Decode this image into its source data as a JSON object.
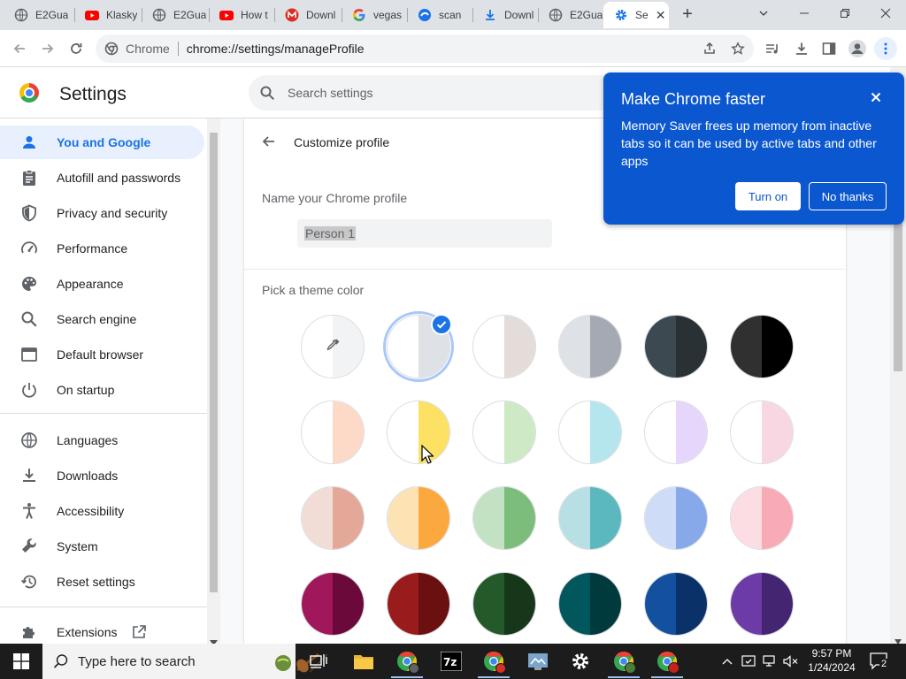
{
  "tabs": [
    {
      "title": "E2Gua",
      "icon": "globe-icon"
    },
    {
      "title": "Klasky",
      "icon": "youtube-icon"
    },
    {
      "title": "E2Gua",
      "icon": "globe-icon"
    },
    {
      "title": "How t",
      "icon": "youtube-icon"
    },
    {
      "title": "Downl",
      "icon": "m-logo-icon"
    },
    {
      "title": "vegas",
      "icon": "google-icon"
    },
    {
      "title": "scan",
      "icon": "swirl-icon"
    },
    {
      "title": "Downl",
      "icon": "download-icon"
    },
    {
      "title": "E2Gua",
      "icon": "globe-icon"
    },
    {
      "title": "Se",
      "icon": "gear-icon"
    }
  ],
  "omnibox": {
    "site_label": "Chrome",
    "url": "chrome://settings/manageProfile"
  },
  "header": {
    "title": "Settings",
    "search_placeholder": "Search settings"
  },
  "sidebar": {
    "items": [
      {
        "label": "You and Google",
        "icon": "person-icon",
        "selected": true
      },
      {
        "label": "Autofill and passwords",
        "icon": "clipboard-icon"
      },
      {
        "label": "Privacy and security",
        "icon": "shield-icon"
      },
      {
        "label": "Performance",
        "icon": "gauge-icon"
      },
      {
        "label": "Appearance",
        "icon": "palette-icon"
      },
      {
        "label": "Search engine",
        "icon": "search-icon"
      },
      {
        "label": "Default browser",
        "icon": "browser-icon"
      },
      {
        "label": "On startup",
        "icon": "power-icon"
      },
      {
        "label": "Languages",
        "icon": "globe-icon"
      },
      {
        "label": "Downloads",
        "icon": "download-icon"
      },
      {
        "label": "Accessibility",
        "icon": "accessibility-icon"
      },
      {
        "label": "System",
        "icon": "wrench-icon"
      },
      {
        "label": "Reset settings",
        "icon": "history-icon"
      },
      {
        "label": "Extensions",
        "icon": "puzzle-icon"
      }
    ]
  },
  "main": {
    "page_title": "Customize profile",
    "name_label": "Name your Chrome profile",
    "name_value": "Person 1",
    "theme_label": "Pick a theme color",
    "swatches": [
      {
        "left": "#ffffff",
        "right": "#f1f3f4"
      },
      {
        "left": "#ffffff",
        "right": "#dee1e6",
        "selected": true
      },
      {
        "left": "#ffffff",
        "right": "#e3dcd8"
      },
      {
        "left": "#dee1e6",
        "right": "#a5a9b4"
      },
      {
        "left": "#3c4950",
        "right": "#2a3135"
      },
      {
        "left": "#303030",
        "right": "#000000"
      },
      {
        "left": "#ffffff",
        "right": "#fdd9c7"
      },
      {
        "left": "#ffffff",
        "right": "#fde164"
      },
      {
        "left": "#ffffff",
        "right": "#cdeac5"
      },
      {
        "left": "#ffffff",
        "right": "#b5e6ee"
      },
      {
        "left": "#ffffff",
        "right": "#e6d6fc"
      },
      {
        "left": "#ffffff",
        "right": "#f8d7e3"
      },
      {
        "left": "#f2ddd6",
        "right": "#e3a897"
      },
      {
        "left": "#fde3b4",
        "right": "#fba93e"
      },
      {
        "left": "#c2e2c3",
        "right": "#7cbd7c"
      },
      {
        "left": "#b8e0e4",
        "right": "#5bb8bf"
      },
      {
        "left": "#cedcf8",
        "right": "#87a9ea"
      },
      {
        "left": "#fcdde3",
        "right": "#f8aab7"
      },
      {
        "left": "#a0175b",
        "right": "#6b0a3a"
      },
      {
        "left": "#9a1b1b",
        "right": "#6b1010"
      },
      {
        "left": "#245a29",
        "right": "#16371a"
      },
      {
        "left": "#02575c",
        "right": "#013a3d"
      },
      {
        "left": "#1351a0",
        "right": "#0a3268"
      },
      {
        "left": "#6c3ba8",
        "right": "#432572"
      }
    ]
  },
  "promo": {
    "title": "Make Chrome faster",
    "body": "Memory Saver frees up memory from inactive tabs so it can be used by active tabs and other apps",
    "turn_on": "Turn on",
    "no_thanks": "No thanks"
  },
  "taskbar": {
    "search_label": "Type here to search",
    "time": "9:57 PM",
    "date": "1/24/2024",
    "notification_count": "2"
  },
  "colors": {
    "accent": "#1a73e8",
    "promo_bg": "#0b57d0",
    "nav_selected_bg": "#e8f0fe"
  }
}
